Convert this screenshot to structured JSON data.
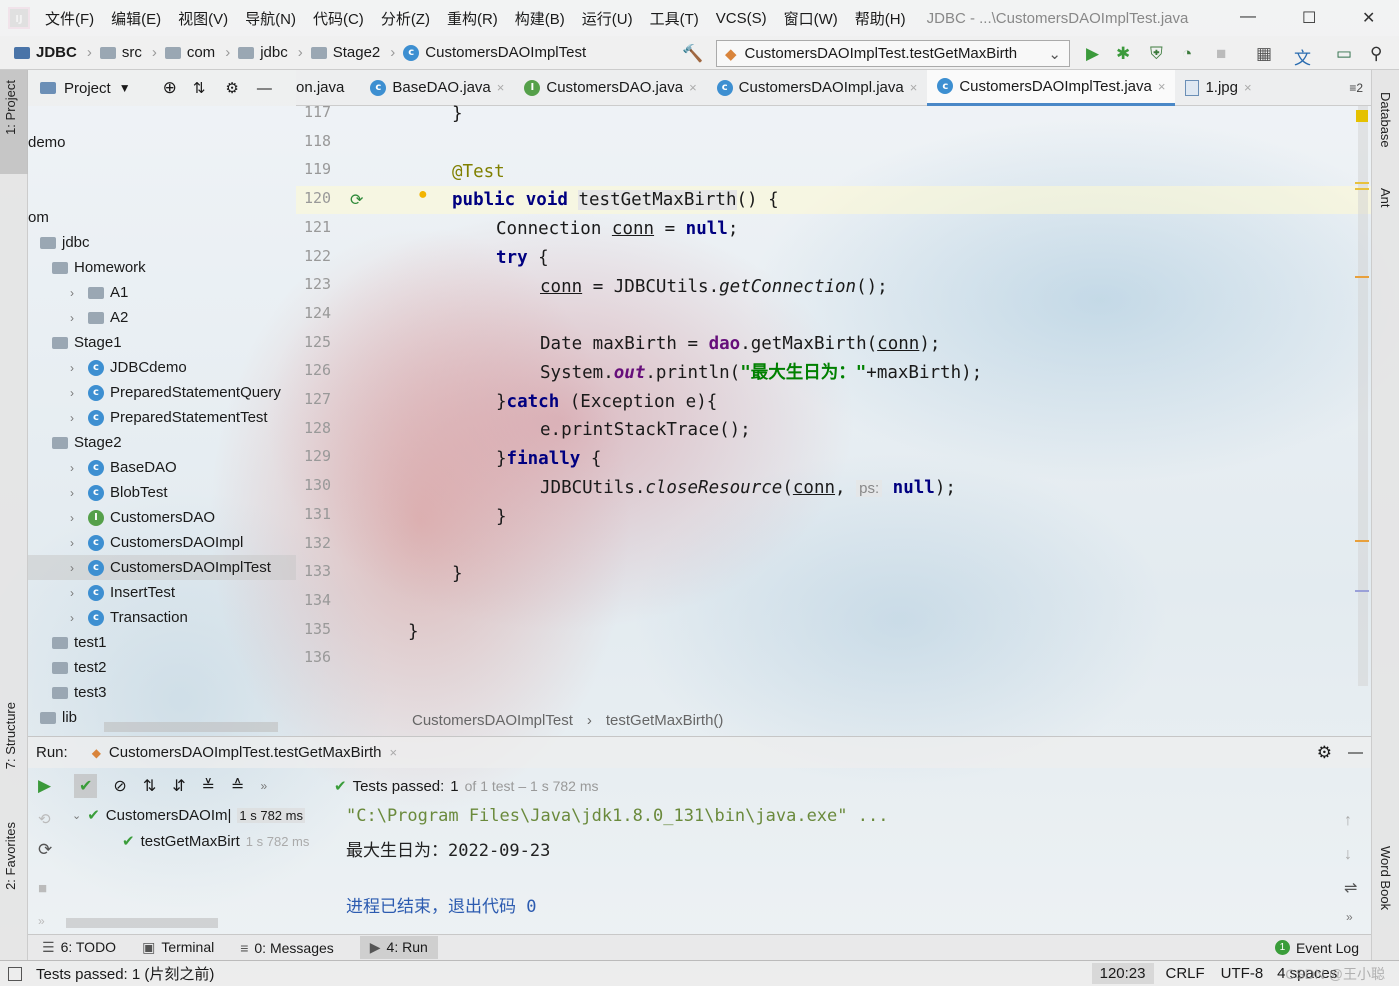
{
  "menu": {
    "items": [
      "文件(F)",
      "编辑(E)",
      "视图(V)",
      "导航(N)",
      "代码(C)",
      "分析(Z)",
      "重构(R)",
      "构建(B)",
      "运行(U)",
      "工具(T)",
      "VCS(S)",
      "窗口(W)",
      "帮助(H)"
    ],
    "window_title": "JDBC - ...\\CustomersDAOImplTest.java"
  },
  "nav": {
    "crumbs": [
      "JDBC",
      "src",
      "com",
      "jdbc",
      "Stage2",
      "CustomersDAOImplTest"
    ],
    "run_config": "CustomersDAOImplTest.testGetMaxBirth"
  },
  "left_strip": {
    "project": "1: Project",
    "structure": "7: Structure",
    "favorites": "2: Favorites"
  },
  "right_strip": {
    "database": "Database",
    "ant": "Ant",
    "word_book": "Word Book"
  },
  "project": {
    "header": "Project",
    "tree": [
      {
        "label": "demo",
        "indent": 0,
        "icon": "none",
        "arrow": ""
      },
      {
        "label": "om",
        "indent": 0,
        "icon": "none",
        "arrow": ""
      },
      {
        "label": "jdbc",
        "indent": 1,
        "icon": "folder",
        "arrow": ""
      },
      {
        "label": "Homework",
        "indent": 2,
        "icon": "folder",
        "arrow": ""
      },
      {
        "label": "A1",
        "indent": 3,
        "icon": "folder",
        "arrow": "›"
      },
      {
        "label": "A2",
        "indent": 3,
        "icon": "folder",
        "arrow": "›"
      },
      {
        "label": "Stage1",
        "indent": 2,
        "icon": "folder",
        "arrow": ""
      },
      {
        "label": "JDBCdemo",
        "indent": 3,
        "icon": "class",
        "arrow": "›"
      },
      {
        "label": "PreparedStatementQuery",
        "indent": 3,
        "icon": "class",
        "arrow": "›"
      },
      {
        "label": "PreparedStatementTest",
        "indent": 3,
        "icon": "class",
        "arrow": "›"
      },
      {
        "label": "Stage2",
        "indent": 2,
        "icon": "folder",
        "arrow": ""
      },
      {
        "label": "BaseDAO",
        "indent": 3,
        "icon": "class",
        "arrow": "›"
      },
      {
        "label": "BlobTest",
        "indent": 3,
        "icon": "class",
        "arrow": "›"
      },
      {
        "label": "CustomersDAO",
        "indent": 3,
        "icon": "interface",
        "arrow": "›"
      },
      {
        "label": "CustomersDAOImpl",
        "indent": 3,
        "icon": "class",
        "arrow": "›"
      },
      {
        "label": "CustomersDAOImplTest",
        "indent": 3,
        "icon": "class",
        "arrow": "›",
        "selected": true
      },
      {
        "label": "InsertTest",
        "indent": 3,
        "icon": "class",
        "arrow": "›"
      },
      {
        "label": "Transaction",
        "indent": 3,
        "icon": "class",
        "arrow": "›"
      },
      {
        "label": "test1",
        "indent": 2,
        "icon": "folder",
        "arrow": ""
      },
      {
        "label": "test2",
        "indent": 2,
        "icon": "folder",
        "arrow": ""
      },
      {
        "label": "test3",
        "indent": 2,
        "icon": "folder",
        "arrow": ""
      },
      {
        "label": "lib",
        "indent": 1,
        "icon": "folder",
        "arrow": ""
      }
    ]
  },
  "tabs": [
    {
      "label": "on.java",
      "icon": "none",
      "close": ""
    },
    {
      "label": "BaseDAO.java",
      "icon": "class",
      "close": "×"
    },
    {
      "label": "CustomersDAO.java",
      "icon": "interface",
      "close": "×"
    },
    {
      "label": "CustomersDAOImpl.java",
      "icon": "class",
      "close": "×"
    },
    {
      "label": "CustomersDAOImplTest.java",
      "icon": "class",
      "close": "×",
      "active": true
    },
    {
      "label": "1.jpg",
      "icon": "image",
      "close": "×"
    }
  ],
  "tab_overflow": "≡2",
  "editor": {
    "line_numbers": [
      "117",
      "118",
      "119",
      "120",
      "121",
      "122",
      "123",
      "124",
      "125",
      "126",
      "127",
      "128",
      "129",
      "130",
      "131",
      "132",
      "133",
      "134",
      "135",
      "136"
    ],
    "breadcrumb": [
      "CustomersDAOImplTest",
      "testGetMaxBirth()"
    ]
  },
  "code": {
    "l117": "}",
    "ann": "@Test",
    "kw_public": "public",
    "kw_void": "void",
    "method": "testGetMaxBirth",
    "sig_tail": "() {",
    "conn_type": "Connection ",
    "conn_var": "conn",
    "eq": " = ",
    "kw_null": "null",
    "semi": ";",
    "kw_try": "try",
    "brace_open": " {",
    "conn_eq": " = JDBCUtils.",
    "get_conn": "getConnection",
    "call_end": "();",
    "date_decl": "Date maxBirth = ",
    "dao": "dao",
    "get_max": ".getMaxBirth(",
    "close_semi": ");",
    "sys": "System.",
    "out": "out",
    "println": ".println(",
    "str": "\"最大生日为：\"",
    "plus": "+maxBirth);",
    "catch_open": "}",
    "kw_catch": "catch",
    "catch_tail": " (Exception e){",
    "print_trace": "e.printStackTrace();",
    "finally_open": "}",
    "kw_finally": "finally",
    "close_res_a": "JDBCUtils.",
    "close_res": "closeResource",
    "paren_open": "(",
    "comma": ", ",
    "ps_hint": "ps:",
    "end": ");",
    "rb": "}"
  },
  "run": {
    "label": "Run:",
    "config": "CustomersDAOImplTest.testGetMaxBirth",
    "tests_passed": "Tests passed:",
    "passed_count": "1",
    "of_total": "of 1 test – 1 s 782 ms",
    "tree": [
      {
        "label": "CustomersDAOIm|",
        "time": "1 s 782 ms"
      },
      {
        "label": "testGetMaxBirt",
        "time": "1 s 782 ms"
      }
    ],
    "console": [
      "\"C:\\Program Files\\Java\\jdk1.8.0_131\\bin\\java.exe\" ...",
      "最大生日为：2022-09-23",
      "",
      "进程已结束，退出代码 0"
    ]
  },
  "bottom_tabs": [
    {
      "label": "6: TODO"
    },
    {
      "label": "Terminal"
    },
    {
      "label": "0: Messages"
    },
    {
      "label": "4: Run",
      "active": true
    }
  ],
  "event_log": "Event Log",
  "event_count": "1",
  "status": {
    "message": "Tests passed: 1 (片刻之前)",
    "position": "120:23",
    "line_sep": "CRLF",
    "encoding": "UTF-8",
    "indent": "4 spaces"
  },
  "watermark": "CSDN @王小聪",
  "colors": {
    "accent": "#4a88c7",
    "keyword": "#000080",
    "string": "#008000",
    "annotation": "#808000",
    "field": "#660e7a",
    "pass": "#3a9d3a"
  }
}
